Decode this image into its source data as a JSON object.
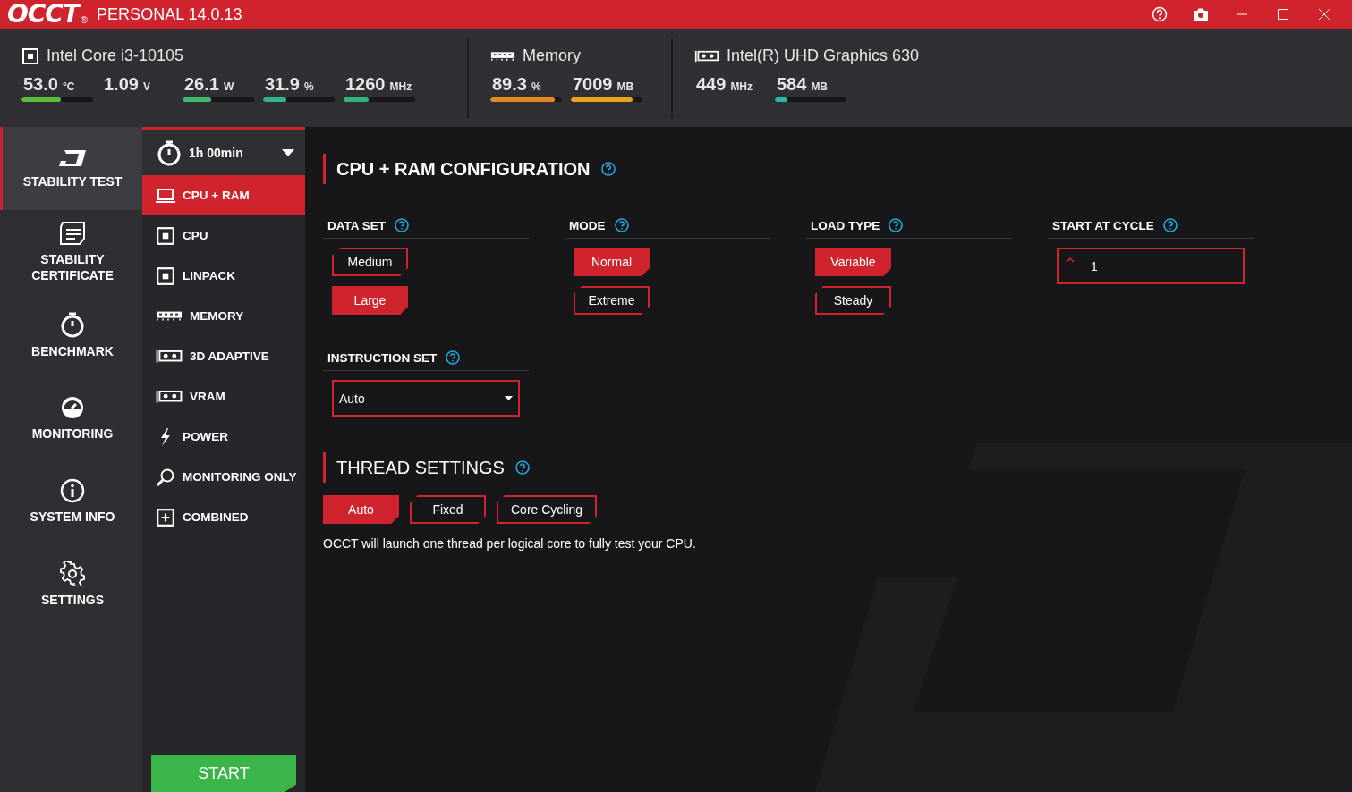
{
  "title_bar": {
    "logo": "OCCT",
    "logo_mark": "®",
    "edition": "PERSONAL 14.0.13"
  },
  "panels": [
    {
      "kind": "cpu",
      "name": "Intel Core i3-10105",
      "metrics": [
        {
          "value": "53.0",
          "unit": "°C",
          "level": 0.55,
          "color": "#5dbb3a"
        },
        {
          "value": "1.09",
          "unit": "V"
        },
        {
          "value": "26.1",
          "unit": "W",
          "level": 0.4,
          "color": "#3fb66a"
        },
        {
          "value": "31.9",
          "unit": "%",
          "level": 0.32,
          "color": "#2fb68a"
        },
        {
          "value": "1260",
          "unit": "MHz",
          "level": 0.35,
          "color": "#2fb67a"
        }
      ]
    },
    {
      "kind": "memory",
      "name": "Memory",
      "metrics": [
        {
          "value": "89.3",
          "unit": "%",
          "level": 0.9,
          "color": "#e58a1f"
        },
        {
          "value": "7009",
          "unit": "MB",
          "level": 0.86,
          "color": "#e8a41f"
        }
      ]
    },
    {
      "kind": "gpu",
      "name": "Intel(R) UHD Graphics 630",
      "metrics": [
        {
          "value": "449",
          "unit": "MHz"
        },
        {
          "value": "584",
          "unit": "MB",
          "level": 0.18,
          "color": "#2ab5b0"
        }
      ]
    }
  ],
  "nav": [
    {
      "kind": "stability",
      "label": "STABILITY TEST",
      "selected": true
    },
    {
      "kind": "certificate",
      "label": "STABILITY CERTIFICATE",
      "selected": false
    },
    {
      "kind": "benchmark",
      "label": "BENCHMARK",
      "selected": false
    },
    {
      "kind": "monitoring",
      "label": "MONITORING",
      "selected": false
    },
    {
      "kind": "info",
      "label": "SYSTEM INFO",
      "selected": false
    },
    {
      "kind": "settings",
      "label": "SETTINGS",
      "selected": false
    }
  ],
  "tests": {
    "duration": "1h 00min",
    "items": [
      {
        "kind": "laptop",
        "label": "CPU + RAM",
        "selected": true
      },
      {
        "kind": "chip",
        "label": "CPU",
        "selected": false
      },
      {
        "kind": "chip",
        "label": "LINPACK",
        "selected": false
      },
      {
        "kind": "memory",
        "label": "MEMORY",
        "selected": false
      },
      {
        "kind": "gpu",
        "label": "3D ADAPTIVE",
        "selected": false
      },
      {
        "kind": "gpu",
        "label": "VRAM",
        "selected": false
      },
      {
        "kind": "power",
        "label": "POWER",
        "selected": false
      },
      {
        "kind": "search",
        "label": "MONITORING ONLY",
        "selected": false
      },
      {
        "kind": "plus",
        "label": "COMBINED",
        "selected": false
      }
    ],
    "start": "START"
  },
  "config": {
    "title": "CPU + RAM CONFIGURATION",
    "groups": [
      {
        "kind": "choice",
        "label": "DATA SET",
        "options": [
          {
            "label": "Medium",
            "selected": false
          },
          {
            "label": "Large",
            "selected": true
          }
        ]
      },
      {
        "kind": "choice",
        "label": "MODE",
        "options": [
          {
            "label": "Normal",
            "selected": true
          },
          {
            "label": "Extreme",
            "selected": false
          }
        ]
      },
      {
        "kind": "choice",
        "label": "LOAD TYPE",
        "options": [
          {
            "label": "Variable",
            "selected": true
          },
          {
            "label": "Steady",
            "selected": false
          }
        ]
      },
      {
        "kind": "number",
        "label": "START AT CYCLE",
        "value": "1"
      },
      {
        "kind": "select",
        "label": "INSTRUCTION SET",
        "value": "Auto"
      }
    ]
  },
  "threads": {
    "title": "THREAD SETTINGS",
    "options": [
      {
        "label": "Auto",
        "selected": true
      },
      {
        "label": "Fixed",
        "selected": false
      },
      {
        "label": "Core Cycling",
        "selected": false
      }
    ],
    "description": "OCCT will launch one thread per logical core to fully test your CPU."
  }
}
